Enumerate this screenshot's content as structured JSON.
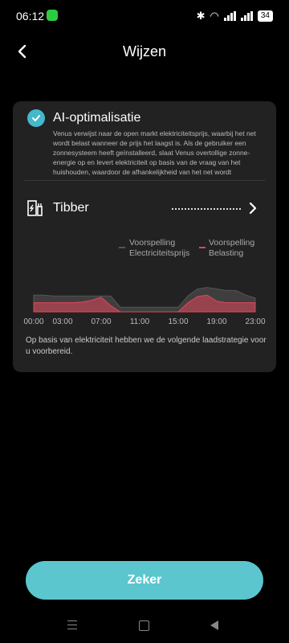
{
  "status_bar": {
    "time": "06:12",
    "battery": "34"
  },
  "header": {
    "title": "Wijzen"
  },
  "optimization": {
    "title": "AI-optimalisatie",
    "description": "Venus verwijst naar de open markt elektriciteitsprijs, waarbij het net wordt belast wanneer de prijs het laagst is. Als de gebruiker een zonnesysteem heeft geïnstalleerd, slaat Venus overtollige zonne-energie op en levert elektriciteit op basis van de vraag van het huishouden, waardoor de afhankelijkheid van het net wordt",
    "checked": true
  },
  "provider": {
    "name": "Tibber"
  },
  "legend": {
    "price": {
      "line1": "Voorspelling",
      "line2": "Electriciteitsprijs",
      "color": "#555555"
    },
    "load": {
      "line1": "Voorspelling",
      "line2": "Belasting",
      "color": "#e0475b"
    }
  },
  "chart_data": {
    "type": "area",
    "x": [
      "00:00",
      "01:00",
      "02:00",
      "03:00",
      "04:00",
      "05:00",
      "06:00",
      "07:00",
      "08:00",
      "09:00",
      "10:00",
      "11:00",
      "12:00",
      "13:00",
      "14:00",
      "15:00",
      "16:00",
      "17:00",
      "18:00",
      "19:00",
      "20:00",
      "21:00",
      "22:00",
      "23:00"
    ],
    "xticks": [
      "00:00",
      "03:00",
      "07:00",
      "11:00",
      "15:00",
      "19:00",
      "23:00"
    ],
    "series": [
      {
        "name": "Voorspelling Electriciteitsprijs",
        "color": "#555555",
        "values": [
          0.55,
          0.55,
          0.52,
          0.52,
          0.52,
          0.52,
          0.52,
          0.52,
          0.52,
          0.15,
          0.15,
          0.15,
          0.15,
          0.15,
          0.15,
          0.15,
          0.52,
          0.75,
          0.8,
          0.75,
          0.7,
          0.7,
          0.55,
          0.45
        ]
      },
      {
        "name": "Voorspelling Belasting",
        "color": "#e0475b",
        "values": [
          0.3,
          0.3,
          0.3,
          0.3,
          0.3,
          0.32,
          0.38,
          0.48,
          0.2,
          0.0,
          0.0,
          0.0,
          0.0,
          0.0,
          0.0,
          0.0,
          0.3,
          0.5,
          0.55,
          0.35,
          0.3,
          0.3,
          0.3,
          0.3
        ]
      }
    ]
  },
  "strategy_text": "Op basis van elektriciteit hebben we de volgende laadstrategie voor u voorbereid.",
  "cta": {
    "label": "Zeker"
  }
}
